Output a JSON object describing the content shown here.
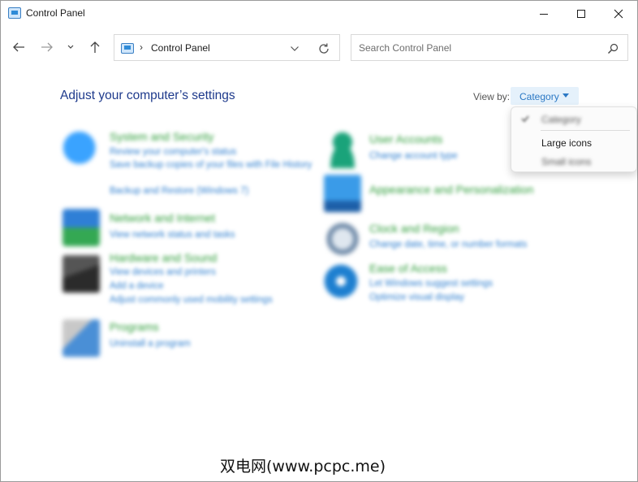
{
  "window": {
    "title": "Control Panel"
  },
  "title_buttons": {
    "minimize": "minimize-icon",
    "maximize": "maximize-icon",
    "close": "close-icon"
  },
  "nav": {
    "back": "arrow-left-icon",
    "forward": "arrow-right-icon",
    "recent": "chevron-down-icon",
    "up": "arrow-up-icon"
  },
  "address": {
    "separator": "›",
    "path": "Control Panel"
  },
  "search": {
    "placeholder": "Search Control Panel"
  },
  "content": {
    "heading": "Adjust your computer’s settings"
  },
  "viewby": {
    "label": "View by:",
    "value": "Category",
    "options": [
      {
        "label": "Category",
        "selected": true
      },
      {
        "label": "Large icons",
        "selected": false
      },
      {
        "label": "Small icons",
        "selected": false
      }
    ]
  },
  "categories": [
    {
      "title": "System and Security",
      "links": [
        "Review your computer's status",
        "Save backup copies of your files with File History",
        "Backup and Restore (Windows 7)"
      ],
      "color": "#1f86d9"
    },
    {
      "title": "Network and Internet",
      "links": [
        "View network status and tasks"
      ],
      "color": "#2a8a3a"
    },
    {
      "title": "Hardware and Sound",
      "links": [
        "View devices and printers",
        "Add a device",
        "Adjust commonly used mobility settings"
      ],
      "color": "#3c3c3c"
    },
    {
      "title": "Programs",
      "links": [
        "Uninstall a program"
      ],
      "color": "#4a8fd6"
    },
    {
      "title": "User Accounts",
      "links": [
        "Change account type"
      ],
      "color": "#1aa37a"
    },
    {
      "title": "Appearance and Personalization",
      "links": [],
      "color": "#2f8bd8"
    },
    {
      "title": "Clock and Region",
      "links": [
        "Change date, time, or number formats"
      ],
      "color": "#6f8aa8"
    },
    {
      "title": "Ease of Access",
      "links": [
        "Let Windows suggest settings",
        "Optimize visual display"
      ],
      "color": "#1d7fd0"
    }
  ],
  "watermark": "双电网(www.pcpc.me)"
}
